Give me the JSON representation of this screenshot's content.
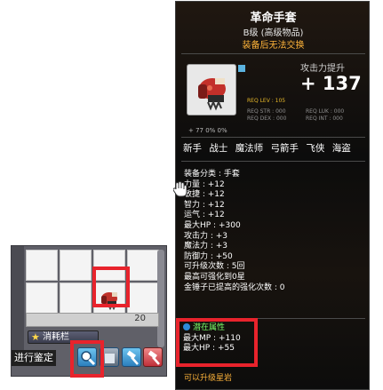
{
  "inventory": {
    "quantity_text": "20",
    "tab_label": "消耗栏",
    "appraise_label": "进行鉴定"
  },
  "tooltip": {
    "title": "革命手套",
    "grade": "B级 (高级物品)",
    "trade_notice": "装备后无法交换",
    "attack_label": "攻击力提升",
    "attack_value": "+ 137",
    "req_level": "REQ LEV : 105",
    "req_str": "REQ STR : 000",
    "req_luk": "REQ LUK : 000",
    "req_dex": "REQ DEX : 000",
    "req_int": "REQ INT : 000",
    "mini_icons": "+ 77          0%          0%",
    "jobs": [
      "新手",
      "战士",
      "魔法师",
      "弓箭手",
      "飞侠",
      "海盗"
    ],
    "stats": [
      {
        "label": "装备分类 : 手套"
      },
      {
        "label": "力量 : +12"
      },
      {
        "label": "敏捷 : +12"
      },
      {
        "label": "智力 : +12"
      },
      {
        "label": "运气 : +12"
      },
      {
        "label": "最大HP : +300"
      },
      {
        "label": "攻击力 : +3"
      },
      {
        "label": "魔法力 : +3"
      },
      {
        "label": "防御力 : +50"
      },
      {
        "label": "可升级次数 : 5回"
      },
      {
        "label": "最高可强化到0星"
      },
      {
        "label": "金锤子已提高的强化次数 : 0"
      }
    ],
    "potential_title": "潜在属性",
    "potential_lines": [
      "最大MP : +110",
      "最大HP : +55"
    ],
    "upgrade_hint": "可以升级星岩"
  },
  "colors": {
    "highlight": "#e8232c",
    "potential": "#7cff6a",
    "notice": "#ffb43a"
  }
}
